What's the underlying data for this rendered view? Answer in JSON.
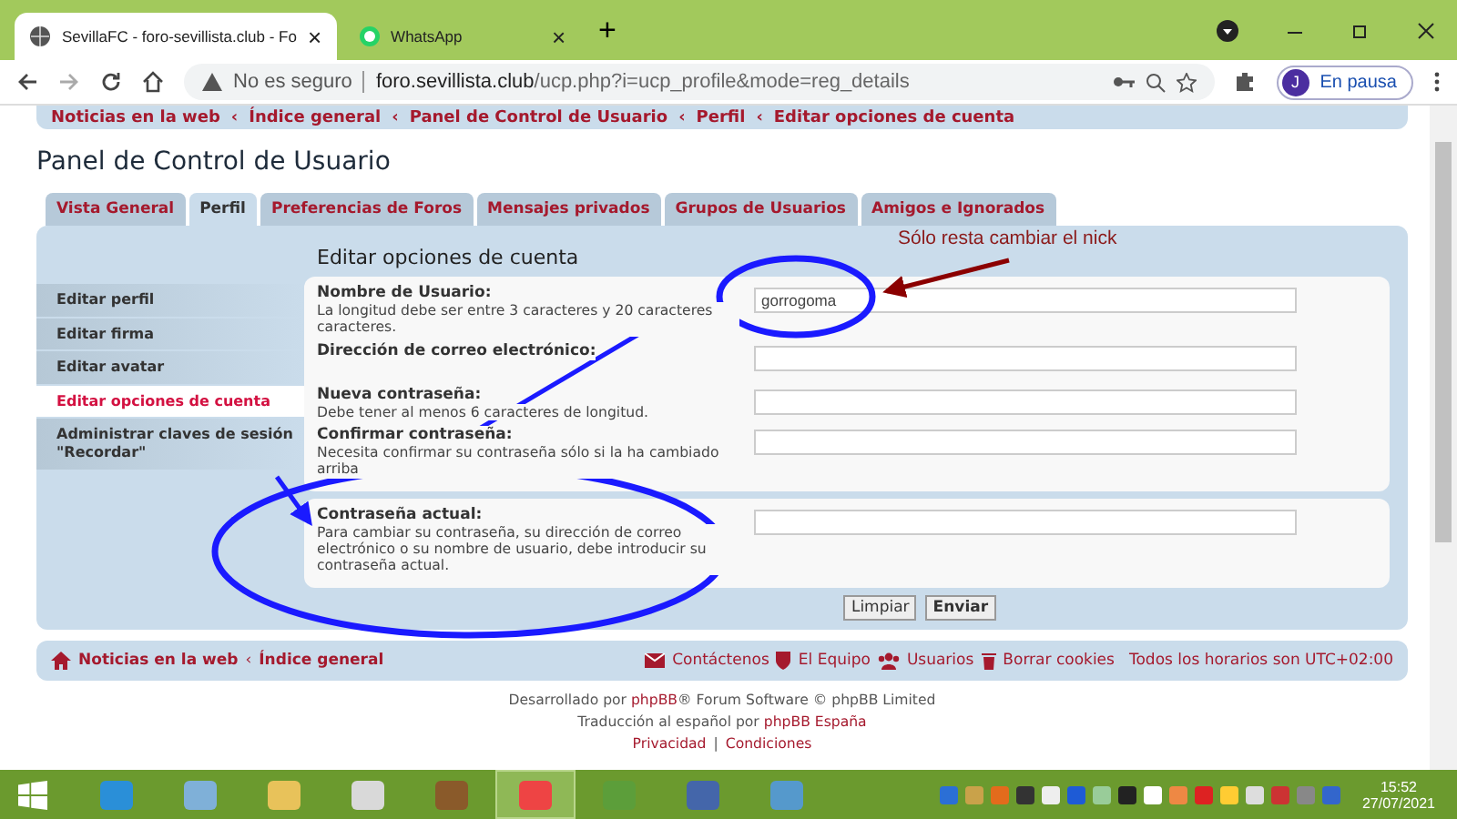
{
  "browser": {
    "tabs": [
      {
        "title": "SevillaFC - foro-sevillista.club - Fo",
        "selected": true,
        "close": "×"
      },
      {
        "title": "WhatsApp",
        "selected": false,
        "close": "×"
      }
    ],
    "new_tab": "+",
    "security": "No es seguro",
    "url_host": "foro.sevillista.club",
    "url_path": "/ucp.php?i=ucp_profile&mode=reg_details",
    "profile_initial": "J",
    "profile_status": "En pausa"
  },
  "breadcrumb": [
    {
      "label": "Noticias en la web"
    },
    {
      "sep": "‹",
      "label": "Índice general"
    },
    {
      "sep": "‹",
      "label": "Panel de Control de Usuario"
    },
    {
      "sep": "‹",
      "label": "Perfil"
    },
    {
      "sep": "‹",
      "label": "Editar opciones de cuenta"
    }
  ],
  "page_title": "Panel de Control de Usuario",
  "tabs": [
    {
      "label": "Vista General",
      "selected": false
    },
    {
      "label": "Perfil",
      "selected": true
    },
    {
      "label": "Preferencias de Foros",
      "selected": false
    },
    {
      "label": "Mensajes privados",
      "selected": false
    },
    {
      "label": "Grupos de Usuarios",
      "selected": false
    },
    {
      "label": "Amigos e Ignorados",
      "selected": false
    }
  ],
  "sidebar": [
    {
      "label": "Editar perfil",
      "selected": false
    },
    {
      "label": "Editar firma",
      "selected": false
    },
    {
      "label": "Editar avatar",
      "selected": false
    },
    {
      "label": "Editar opciones de cuenta",
      "selected": true
    },
    {
      "label": "Administrar claves de sesión \"Recordar\"",
      "selected": false
    }
  ],
  "section_title": "Editar opciones de cuenta",
  "fields": [
    {
      "label": "Nombre de Usuario:",
      "hint": "La longitud debe ser entre 3 caracteres y 20 caracteres caracteres.",
      "value": "gorrogoma"
    },
    {
      "label": "Dirección de correo electrónico:"
    },
    {
      "label": "Nueva contraseña:",
      "hint": "Debe tener al menos 6 caracteres de longitud."
    },
    {
      "label": "Confirmar contraseña:",
      "hint": "Necesita confirmar su contraseña sólo si la ha cambiado arriba"
    }
  ],
  "current_password": {
    "label": "Contraseña actual:",
    "hint": "Para cambiar su contraseña, su dirección de correo electrónico o su nombre de usuario, debe introducir su contraseña actual."
  },
  "buttons": [
    "Limpiar",
    "Enviar"
  ],
  "annotation": "Sólo resta cambiar el nick",
  "footer_nav": {
    "left": [
      {
        "label": "Noticias en la web"
      },
      {
        "sep": "‹",
        "label": "Índice general"
      }
    ],
    "right": [
      "Contáctenos",
      "El Equipo",
      "Usuarios",
      "Borrar cookies"
    ],
    "timezone": "Todos los horarios son UTC+02:00"
  },
  "credits": [
    {
      "before": "Desarrollado por ",
      "link": "phpBB",
      "after": "® Forum Software © phpBB Limited"
    },
    {
      "before": "Traducción al español por ",
      "link": "phpBB España"
    }
  ],
  "legal": [
    {
      "label": "Privacidad"
    },
    {
      "sep": "|",
      "label": "Condiciones"
    }
  ],
  "taskbar": {
    "time": "15:52",
    "date": "27/07/2021"
  }
}
